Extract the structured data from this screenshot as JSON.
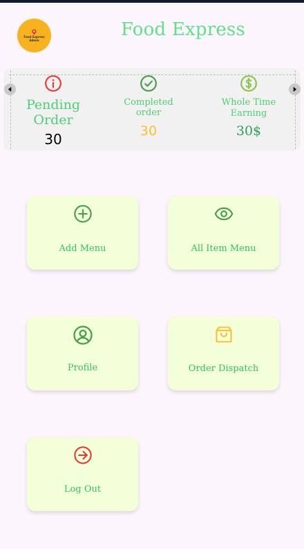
{
  "app": {
    "title": "Food Express"
  },
  "logo": {
    "line1": "Food Express",
    "line2": "Admin"
  },
  "stats": {
    "pending": {
      "label": "Pending Order",
      "value": "30"
    },
    "completed": {
      "label": "Completed order",
      "value": "30"
    },
    "earning": {
      "label": "Whole Time Earning",
      "value": "30$"
    }
  },
  "menu": {
    "add_menu": "Add Menu",
    "all_item_menu": "All Item Menu",
    "profile": "Profile",
    "order_dispatch": "Order Dispatch",
    "log_out": "Log Out"
  },
  "icons": {
    "pending": "info-circle-icon",
    "completed": "check-circle-icon",
    "earning": "dollar-circle-icon",
    "add_menu": "plus-circle-icon",
    "all_item_menu": "eye-icon",
    "profile": "user-circle-icon",
    "order_dispatch": "shopping-bag-icon",
    "log_out": "arrow-right-circle-icon"
  },
  "colors": {
    "accent_green": "#5fe08a",
    "tile_background": "#f2ffd9",
    "pending_icon": "#e53935",
    "completed_icon": "#43a047",
    "completed_value": "#fbc02d",
    "earning_icon": "#8bc34a",
    "earning_value": "#2e9e5b",
    "order_dispatch_icon": "#fbc02d",
    "log_out_icon": "#e53935"
  }
}
